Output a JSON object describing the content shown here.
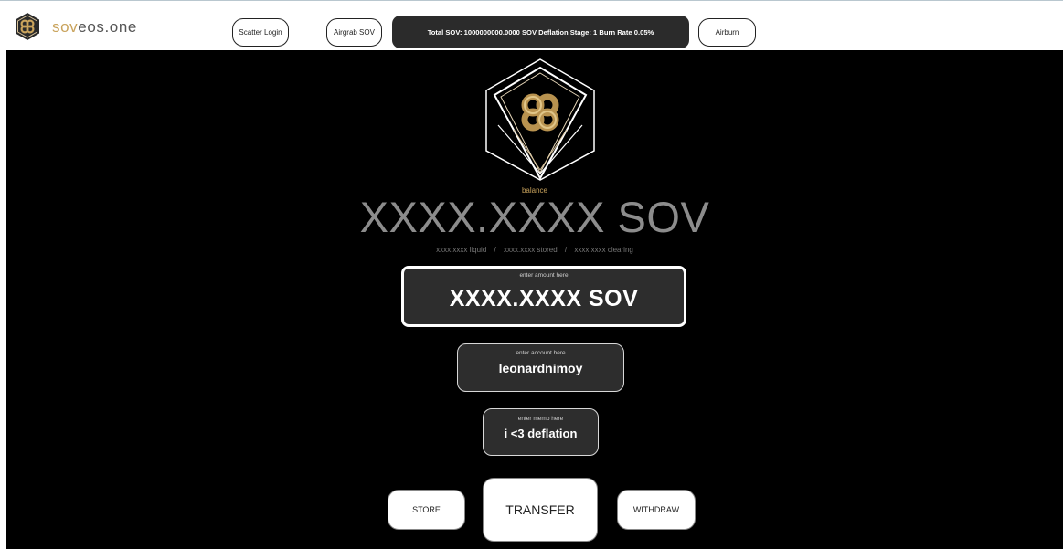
{
  "brand": {
    "name_accent": "sov",
    "name_rest": "eos.one",
    "accent_color": "#c9a35c"
  },
  "nav": {
    "scatter_login": "Scatter Login",
    "airgrab": "Airgrab SOV",
    "stats": "Total SOV: 1000000000.0000 SOV Deflation Stage: 1 Burn Rate 0.05%",
    "airburn": "Airburn"
  },
  "balance": {
    "label": "balance",
    "value": "XXXX.XXXX SOV",
    "liquid": "xxxx.xxxx liquid",
    "stored": "xxxx.xxxx stored",
    "clearing": "xxxx.xxxx clearing",
    "separator": "/"
  },
  "amount": {
    "hint": "enter amount here",
    "value": "XXXX.XXXX SOV"
  },
  "account": {
    "hint": "enter account here",
    "value": "leonardnimoy"
  },
  "memo": {
    "hint": "enter memo here",
    "value": "i <3 deflation"
  },
  "actions": {
    "store": "STORE",
    "transfer": "TRANSFER",
    "withdraw": "WITHDRAW"
  },
  "icons": {
    "brand_logo": "sov-infinity-hexagon-icon",
    "hero_logo": "sov-diamond-knot-icon"
  }
}
